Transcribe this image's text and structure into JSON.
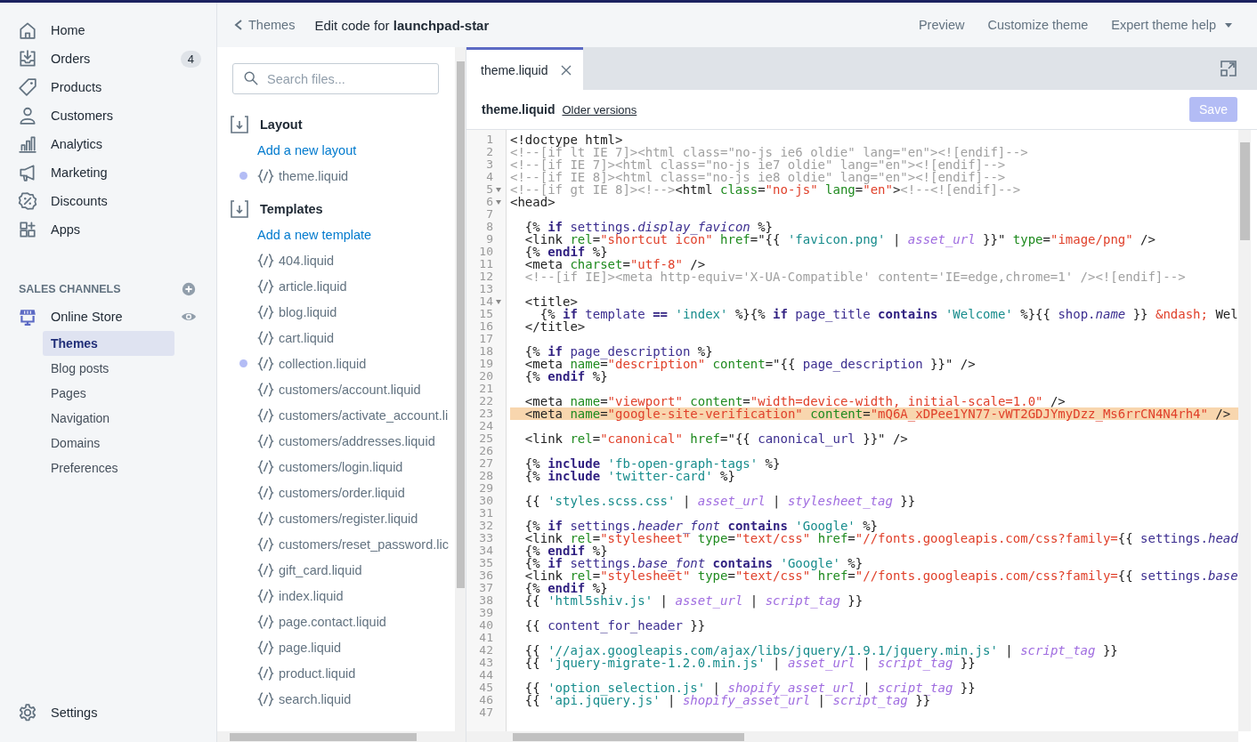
{
  "nav": {
    "items": [
      {
        "label": "Home",
        "selected": false
      },
      {
        "label": "Orders",
        "badge": "4",
        "selected": false
      },
      {
        "label": "Products",
        "selected": false
      },
      {
        "label": "Customers",
        "selected": false
      },
      {
        "label": "Analytics",
        "selected": false
      },
      {
        "label": "Marketing",
        "selected": false
      },
      {
        "label": "Discounts",
        "selected": false
      },
      {
        "label": "Apps",
        "selected": false
      }
    ],
    "channels_heading": "SALES CHANNELS",
    "channel": {
      "label": "Online Store",
      "subitems": [
        {
          "label": "Themes",
          "selected": true
        },
        {
          "label": "Blog posts",
          "selected": false
        },
        {
          "label": "Pages",
          "selected": false
        },
        {
          "label": "Navigation",
          "selected": false
        },
        {
          "label": "Domains",
          "selected": false
        },
        {
          "label": "Preferences",
          "selected": false
        }
      ]
    },
    "settings": "Settings"
  },
  "topbar": {
    "back": "Themes",
    "title": "Edit code for **launchpad-star**",
    "links": [
      {
        "label": "Preview",
        "dropdown": false
      },
      {
        "label": "Customize theme",
        "dropdown": false
      },
      {
        "label": "Expert theme help",
        "dropdown": true
      }
    ]
  },
  "files": {
    "search_placeholder": "Search files...",
    "sections": [
      {
        "title": "Layout",
        "add_link": "Add a new layout",
        "files": [
          {
            "name": "theme.liquid",
            "modified": true
          }
        ]
      },
      {
        "title": "Templates",
        "add_link": "Add a new template",
        "files": [
          {
            "name": "404.liquid",
            "modified": false
          },
          {
            "name": "article.liquid",
            "modified": false
          },
          {
            "name": "blog.liquid",
            "modified": false
          },
          {
            "name": "cart.liquid",
            "modified": false
          },
          {
            "name": "collection.liquid",
            "modified": true
          },
          {
            "name": "customers/account.liquid",
            "modified": false
          },
          {
            "name": "customers/activate_account.li",
            "modified": false
          },
          {
            "name": "customers/addresses.liquid",
            "modified": false
          },
          {
            "name": "customers/login.liquid",
            "modified": false
          },
          {
            "name": "customers/order.liquid",
            "modified": false
          },
          {
            "name": "customers/register.liquid",
            "modified": false
          },
          {
            "name": "customers/reset_password.lic",
            "modified": false
          },
          {
            "name": "gift_card.liquid",
            "modified": false
          },
          {
            "name": "index.liquid",
            "modified": false
          },
          {
            "name": "page.contact.liquid",
            "modified": false
          },
          {
            "name": "page.liquid",
            "modified": false
          },
          {
            "name": "product.liquid",
            "modified": false
          },
          {
            "name": "search.liquid",
            "modified": false
          }
        ]
      }
    ]
  },
  "editor": {
    "tabs": [
      {
        "label": "theme.liquid",
        "selected": true
      }
    ],
    "file_title": "theme.liquid",
    "older_link": "Older versions",
    "save": {
      "label": "Save",
      "disabled": true
    },
    "lines": [
      {
        "number": "1",
        "fold": false,
        "highlighted": false,
        "parts": [
          {
            "kind": "text",
            "text": "<!doctype html>"
          }
        ]
      },
      {
        "number": "2",
        "fold": false,
        "highlighted": false,
        "parts": [
          {
            "kind": "comment",
            "text": "<!--[if lt IE 7]><html class=\"no-js ie6 oldie\" lang=\"en\"><![endif]-->"
          }
        ]
      },
      {
        "number": "3",
        "fold": false,
        "highlighted": false,
        "parts": [
          {
            "kind": "comment",
            "text": "<!--[if IE 7]><html class=\"no-js ie7 oldie\" lang=\"en\"><![endif]-->"
          }
        ]
      },
      {
        "number": "4",
        "fold": false,
        "highlighted": false,
        "parts": [
          {
            "kind": "comment",
            "text": "<!--[if IE 8]><html class=\"no-js ie8 oldie\" lang=\"en\"><![endif]-->"
          }
        ]
      },
      {
        "number": "5",
        "fold": true,
        "highlighted": false,
        "parts": [
          {
            "kind": "comment",
            "text": "<!--[if gt IE 8]><!-->"
          },
          {
            "kind": "text",
            "text": "<html "
          },
          {
            "kind": "attr",
            "text": "class"
          },
          {
            "kind": "text",
            "text": "="
          },
          {
            "kind": "string",
            "text": "\"no-js\" "
          },
          {
            "kind": "attr",
            "text": "lang"
          },
          {
            "kind": "text",
            "text": "="
          },
          {
            "kind": "string",
            "text": "\"en\""
          },
          {
            "kind": "text",
            "text": ">"
          },
          {
            "kind": "comment",
            "text": "<!--<![endif]-->"
          }
        ]
      },
      {
        "number": "6",
        "fold": true,
        "highlighted": false,
        "parts": [
          {
            "kind": "text",
            "text": "<head>"
          }
        ]
      },
      {
        "number": "7",
        "fold": false,
        "highlighted": false
      },
      {
        "number": "8",
        "fold": false,
        "highlighted": false,
        "parts": [
          {
            "kind": "text",
            "text": "  {% "
          },
          {
            "kind": "keyword",
            "text": "if"
          },
          {
            "kind": "var",
            "text": " settings."
          },
          {
            "kind": "prop",
            "text": "display_favicon"
          },
          {
            "kind": "text",
            "text": " %}"
          }
        ]
      },
      {
        "number": "9",
        "fold": false,
        "highlighted": false,
        "parts": [
          {
            "kind": "text",
            "text": "  <link "
          },
          {
            "kind": "attr",
            "text": "rel"
          },
          {
            "kind": "text",
            "text": "="
          },
          {
            "kind": "string",
            "text": "\"shortcut icon\" "
          },
          {
            "kind": "attr",
            "text": "href"
          },
          {
            "kind": "text",
            "text": "=\"{{ "
          },
          {
            "kind": "lstring",
            "text": "'favicon.png'"
          },
          {
            "kind": "text",
            "text": " | "
          },
          {
            "kind": "filter",
            "text": "asset_url"
          },
          {
            "kind": "text",
            "text": " }}\" "
          },
          {
            "kind": "attr",
            "text": "type"
          },
          {
            "kind": "text",
            "text": "="
          },
          {
            "kind": "string",
            "text": "\"image/png\""
          },
          {
            "kind": "text",
            "text": " />"
          }
        ]
      },
      {
        "number": "10",
        "fold": false,
        "highlighted": false,
        "parts": [
          {
            "kind": "text",
            "text": "  {% "
          },
          {
            "kind": "keyword",
            "text": "endif"
          },
          {
            "kind": "text",
            "text": " %}"
          }
        ]
      },
      {
        "number": "11",
        "fold": false,
        "highlighted": false,
        "parts": [
          {
            "kind": "text",
            "text": "  <meta "
          },
          {
            "kind": "attr",
            "text": "charset"
          },
          {
            "kind": "text",
            "text": "="
          },
          {
            "kind": "string",
            "text": "\"utf-8\""
          },
          {
            "kind": "text",
            "text": " />"
          }
        ]
      },
      {
        "number": "12",
        "fold": false,
        "highlighted": false,
        "parts": [
          {
            "kind": "comment",
            "text": "  <!--[if IE]><meta http-equiv='X-UA-Compatible' content='IE=edge,chrome=1' /><![endif]-->"
          }
        ]
      },
      {
        "number": "13",
        "fold": false,
        "highlighted": false
      },
      {
        "number": "14",
        "fold": true,
        "highlighted": false,
        "parts": [
          {
            "kind": "text",
            "text": "  <title>"
          }
        ]
      },
      {
        "number": "15",
        "fold": false,
        "highlighted": false,
        "parts": [
          {
            "kind": "text",
            "text": "    {% "
          },
          {
            "kind": "keyword",
            "text": "if"
          },
          {
            "kind": "var",
            "text": " template "
          },
          {
            "kind": "keyword",
            "text": "== "
          },
          {
            "kind": "lstring",
            "text": "'index'"
          },
          {
            "kind": "text",
            "text": " %}{% "
          },
          {
            "kind": "keyword",
            "text": "if"
          },
          {
            "kind": "var",
            "text": " page_title "
          },
          {
            "kind": "keyword",
            "text": "contains "
          },
          {
            "kind": "lstring",
            "text": "'Welcome'"
          },
          {
            "kind": "text",
            "text": " %}{{ "
          },
          {
            "kind": "var",
            "text": "shop."
          },
          {
            "kind": "prop",
            "text": "name"
          },
          {
            "kind": "text",
            "text": " }} "
          },
          {
            "kind": "entity",
            "text": "&ndash;"
          },
          {
            "kind": "text",
            "text": " Wel"
          }
        ]
      },
      {
        "number": "16",
        "fold": false,
        "highlighted": false,
        "parts": [
          {
            "kind": "text",
            "text": "  </title>"
          }
        ]
      },
      {
        "number": "17",
        "fold": false,
        "highlighted": false
      },
      {
        "number": "18",
        "fold": false,
        "highlighted": false,
        "parts": [
          {
            "kind": "text",
            "text": "  {% "
          },
          {
            "kind": "keyword",
            "text": "if"
          },
          {
            "kind": "var",
            "text": " page_description"
          },
          {
            "kind": "text",
            "text": " %}"
          }
        ]
      },
      {
        "number": "19",
        "fold": false,
        "highlighted": false,
        "parts": [
          {
            "kind": "text",
            "text": "  <meta "
          },
          {
            "kind": "attr",
            "text": "name"
          },
          {
            "kind": "text",
            "text": "="
          },
          {
            "kind": "string",
            "text": "\"description\" "
          },
          {
            "kind": "attr",
            "text": "content"
          },
          {
            "kind": "text",
            "text": "=\"{{ "
          },
          {
            "kind": "var",
            "text": "page_description"
          },
          {
            "kind": "text",
            "text": " }}\" />"
          }
        ]
      },
      {
        "number": "20",
        "fold": false,
        "highlighted": false,
        "parts": [
          {
            "kind": "text",
            "text": "  {% "
          },
          {
            "kind": "keyword",
            "text": "endif"
          },
          {
            "kind": "text",
            "text": " %}"
          }
        ]
      },
      {
        "number": "21",
        "fold": false,
        "highlighted": false
      },
      {
        "number": "22",
        "fold": false,
        "highlighted": false,
        "parts": [
          {
            "kind": "text",
            "text": "  <meta "
          },
          {
            "kind": "attr",
            "text": "name"
          },
          {
            "kind": "text",
            "text": "="
          },
          {
            "kind": "string",
            "text": "\"viewport\" "
          },
          {
            "kind": "attr",
            "text": "content"
          },
          {
            "kind": "text",
            "text": "="
          },
          {
            "kind": "string",
            "text": "\"width=device-width, initial-scale=1.0\""
          },
          {
            "kind": "text",
            "text": " />"
          }
        ]
      },
      {
        "number": "23",
        "fold": false,
        "highlighted": true,
        "parts": [
          {
            "kind": "text",
            "text": "  <meta "
          },
          {
            "kind": "attr",
            "text": "name"
          },
          {
            "kind": "text",
            "text": "="
          },
          {
            "kind": "string",
            "text": "\"google-site-verification\" "
          },
          {
            "kind": "attr",
            "text": "content"
          },
          {
            "kind": "text",
            "text": "="
          },
          {
            "kind": "string",
            "text": "\"mQ6A_xDPee1YN77-vWT2GDJYmyDzz_Ms6rrCN4N4rh4\""
          },
          {
            "kind": "text",
            "text": " />"
          }
        ]
      },
      {
        "number": "24",
        "fold": false,
        "highlighted": false
      },
      {
        "number": "25",
        "fold": false,
        "highlighted": false,
        "parts": [
          {
            "kind": "text",
            "text": "  <link "
          },
          {
            "kind": "attr",
            "text": "rel"
          },
          {
            "kind": "text",
            "text": "="
          },
          {
            "kind": "string",
            "text": "\"canonical\" "
          },
          {
            "kind": "attr",
            "text": "href"
          },
          {
            "kind": "text",
            "text": "=\"{{ "
          },
          {
            "kind": "var",
            "text": "canonical_url"
          },
          {
            "kind": "text",
            "text": " }}\" />"
          }
        ]
      },
      {
        "number": "26",
        "fold": false,
        "highlighted": false
      },
      {
        "number": "27",
        "fold": false,
        "highlighted": false,
        "parts": [
          {
            "kind": "text",
            "text": "  {% "
          },
          {
            "kind": "keyword",
            "text": "include "
          },
          {
            "kind": "lstring",
            "text": "'fb-open-graph-tags'"
          },
          {
            "kind": "text",
            "text": " %}"
          }
        ]
      },
      {
        "number": "28",
        "fold": false,
        "highlighted": false,
        "parts": [
          {
            "kind": "text",
            "text": "  {% "
          },
          {
            "kind": "keyword",
            "text": "include "
          },
          {
            "kind": "lstring",
            "text": "'twitter-card'"
          },
          {
            "kind": "text",
            "text": " %}"
          }
        ]
      },
      {
        "number": "29",
        "fold": false,
        "highlighted": false
      },
      {
        "number": "30",
        "fold": false,
        "highlighted": false,
        "parts": [
          {
            "kind": "text",
            "text": "  {{ "
          },
          {
            "kind": "lstring",
            "text": "'styles.scss.css'"
          },
          {
            "kind": "text",
            "text": " | "
          },
          {
            "kind": "filter",
            "text": "asset_url"
          },
          {
            "kind": "text",
            "text": " | "
          },
          {
            "kind": "filter",
            "text": "stylesheet_tag"
          },
          {
            "kind": "text",
            "text": " }}"
          }
        ]
      },
      {
        "number": "31",
        "fold": false,
        "highlighted": false
      },
      {
        "number": "32",
        "fold": false,
        "highlighted": false,
        "parts": [
          {
            "kind": "text",
            "text": "  {% "
          },
          {
            "kind": "keyword",
            "text": "if"
          },
          {
            "kind": "var",
            "text": " settings."
          },
          {
            "kind": "prop",
            "text": "header_font "
          },
          {
            "kind": "keyword",
            "text": "contains "
          },
          {
            "kind": "lstring",
            "text": "'Google'"
          },
          {
            "kind": "text",
            "text": " %}"
          }
        ]
      },
      {
        "number": "33",
        "fold": false,
        "highlighted": false,
        "parts": [
          {
            "kind": "text",
            "text": "  <link "
          },
          {
            "kind": "attr",
            "text": "rel"
          },
          {
            "kind": "text",
            "text": "="
          },
          {
            "kind": "string",
            "text": "\"stylesheet\" "
          },
          {
            "kind": "attr",
            "text": "type"
          },
          {
            "kind": "text",
            "text": "="
          },
          {
            "kind": "string",
            "text": "\"text/css\" "
          },
          {
            "kind": "attr",
            "text": "href"
          },
          {
            "kind": "text",
            "text": "="
          },
          {
            "kind": "string",
            "text": "\"//fonts.googleapis.com/css?family="
          },
          {
            "kind": "text",
            "text": "{{ "
          },
          {
            "kind": "var",
            "text": "settings."
          },
          {
            "kind": "prop",
            "text": "head"
          }
        ]
      },
      {
        "number": "34",
        "fold": false,
        "highlighted": false,
        "parts": [
          {
            "kind": "text",
            "text": "  {% "
          },
          {
            "kind": "keyword",
            "text": "endif"
          },
          {
            "kind": "text",
            "text": " %}"
          }
        ]
      },
      {
        "number": "35",
        "fold": false,
        "highlighted": false,
        "parts": [
          {
            "kind": "text",
            "text": "  {% "
          },
          {
            "kind": "keyword",
            "text": "if"
          },
          {
            "kind": "var",
            "text": " settings."
          },
          {
            "kind": "prop",
            "text": "base_font "
          },
          {
            "kind": "keyword",
            "text": "contains "
          },
          {
            "kind": "lstring",
            "text": "'Google'"
          },
          {
            "kind": "text",
            "text": " %}"
          }
        ]
      },
      {
        "number": "36",
        "fold": false,
        "highlighted": false,
        "parts": [
          {
            "kind": "text",
            "text": "  <link "
          },
          {
            "kind": "attr",
            "text": "rel"
          },
          {
            "kind": "text",
            "text": "="
          },
          {
            "kind": "string",
            "text": "\"stylesheet\" "
          },
          {
            "kind": "attr",
            "text": "type"
          },
          {
            "kind": "text",
            "text": "="
          },
          {
            "kind": "string",
            "text": "\"text/css\" "
          },
          {
            "kind": "attr",
            "text": "href"
          },
          {
            "kind": "text",
            "text": "="
          },
          {
            "kind": "string",
            "text": "\"//fonts.googleapis.com/css?family="
          },
          {
            "kind": "text",
            "text": "{{ "
          },
          {
            "kind": "var",
            "text": "settings."
          },
          {
            "kind": "prop",
            "text": "base"
          }
        ]
      },
      {
        "number": "37",
        "fold": false,
        "highlighted": false,
        "parts": [
          {
            "kind": "text",
            "text": "  {% "
          },
          {
            "kind": "keyword",
            "text": "endif"
          },
          {
            "kind": "text",
            "text": " %}"
          }
        ]
      },
      {
        "number": "38",
        "fold": false,
        "highlighted": false,
        "parts": [
          {
            "kind": "text",
            "text": "  {{ "
          },
          {
            "kind": "lstring",
            "text": "'html5shiv.js'"
          },
          {
            "kind": "text",
            "text": " | "
          },
          {
            "kind": "filter",
            "text": "asset_url"
          },
          {
            "kind": "text",
            "text": " | "
          },
          {
            "kind": "filter",
            "text": "script_tag"
          },
          {
            "kind": "text",
            "text": " }}"
          }
        ]
      },
      {
        "number": "39",
        "fold": false,
        "highlighted": false
      },
      {
        "number": "40",
        "fold": false,
        "highlighted": false,
        "parts": [
          {
            "kind": "text",
            "text": "  {{ "
          },
          {
            "kind": "var",
            "text": "content_for_header"
          },
          {
            "kind": "text",
            "text": " }}"
          }
        ]
      },
      {
        "number": "41",
        "fold": false,
        "highlighted": false
      },
      {
        "number": "42",
        "fold": false,
        "highlighted": false,
        "parts": [
          {
            "kind": "text",
            "text": "  {{ "
          },
          {
            "kind": "lstring",
            "text": "'//ajax.googleapis.com/ajax/libs/jquery/1.9.1/jquery.min.js'"
          },
          {
            "kind": "text",
            "text": " | "
          },
          {
            "kind": "filter",
            "text": "script_tag"
          },
          {
            "kind": "text",
            "text": " }}"
          }
        ]
      },
      {
        "number": "43",
        "fold": false,
        "highlighted": false,
        "parts": [
          {
            "kind": "text",
            "text": "  {{ "
          },
          {
            "kind": "lstring",
            "text": "'jquery-migrate-1.2.0.min.js'"
          },
          {
            "kind": "text",
            "text": " | "
          },
          {
            "kind": "filter",
            "text": "asset_url"
          },
          {
            "kind": "text",
            "text": " | "
          },
          {
            "kind": "filter",
            "text": "script_tag"
          },
          {
            "kind": "text",
            "text": " }}"
          }
        ]
      },
      {
        "number": "44",
        "fold": false,
        "highlighted": false
      },
      {
        "number": "45",
        "fold": false,
        "highlighted": false,
        "parts": [
          {
            "kind": "text",
            "text": "  {{ "
          },
          {
            "kind": "lstring",
            "text": "'option_selection.js'"
          },
          {
            "kind": "text",
            "text": " | "
          },
          {
            "kind": "filter",
            "text": "shopify_asset_url"
          },
          {
            "kind": "text",
            "text": " | "
          },
          {
            "kind": "filter",
            "text": "script_tag"
          },
          {
            "kind": "text",
            "text": " }}"
          }
        ]
      },
      {
        "number": "46",
        "fold": false,
        "highlighted": false,
        "parts": [
          {
            "kind": "text",
            "text": "  {{ "
          },
          {
            "kind": "lstring",
            "text": "'api.jquery.js'"
          },
          {
            "kind": "text",
            "text": " | "
          },
          {
            "kind": "filter",
            "text": "shopify_asset_url"
          },
          {
            "kind": "text",
            "text": " | "
          },
          {
            "kind": "filter",
            "text": "script_tag"
          },
          {
            "kind": "text",
            "text": " }}"
          }
        ]
      },
      {
        "number": "47",
        "fold": false,
        "highlighted": false
      }
    ]
  }
}
